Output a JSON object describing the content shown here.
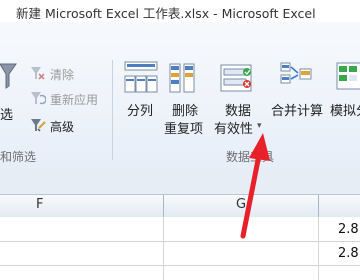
{
  "window": {
    "title": "新建 Microsoft Excel 工作表.xlsx  -  Microsoft Excel"
  },
  "ribbon": {
    "sort_filter": {
      "select_partial": "选",
      "clear": "清除",
      "reapply": "重新应用",
      "advanced": "高级",
      "group_label_partial": "和筛选"
    },
    "data_tools": {
      "text_to_columns": "分列",
      "remove_duplicates_line1": "删除",
      "remove_duplicates_line2": "重复项",
      "data_validation_line1": "数据",
      "data_validation_line2": "有效性",
      "consolidate": "合并计算",
      "what_if_partial": "模拟分",
      "group_label": "数据工具"
    }
  },
  "sheet": {
    "columns": [
      "F",
      "G"
    ],
    "rows": [
      {
        "G": "2.8"
      },
      {
        "G": "2.8"
      }
    ]
  },
  "annotation": {
    "arrow_color": "#e8202a"
  }
}
